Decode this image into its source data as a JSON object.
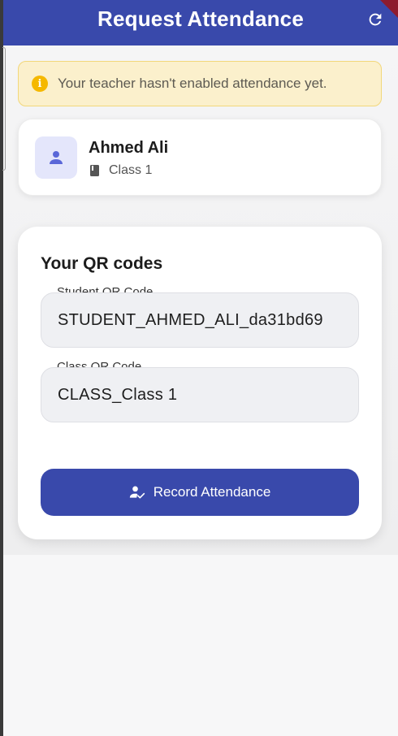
{
  "appbar": {
    "title": "Request Attendance",
    "refresh_icon": "refresh-icon",
    "color": "#3949ab"
  },
  "alert": {
    "icon": "info-icon",
    "icon_glyph": "i",
    "message": "Your teacher hasn't enabled attendance yet.",
    "background": "#fbf0cc",
    "icon_color": "#f5b800"
  },
  "student": {
    "avatar_icon": "person-icon",
    "name": "Ahmed Ali",
    "class_icon": "book-icon",
    "class_name": "Class 1"
  },
  "qr_section": {
    "title": "Your QR codes",
    "student_qr": {
      "label": "Student QR Code",
      "value": "STUDENT_AHMED_ALI_da31bd69"
    },
    "class_qr": {
      "label": "Class QR Code",
      "value": "CLASS_Class 1"
    }
  },
  "record_button": {
    "icon": "person-check-icon",
    "label": "Record Attendance",
    "color": "#3949ab"
  }
}
